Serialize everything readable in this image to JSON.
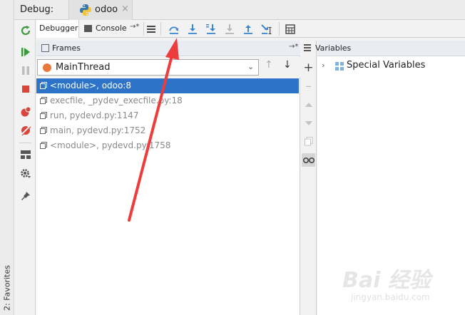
{
  "title_bar": {
    "debug_label": "Debug:",
    "run_tab_label": "odoo",
    "run_tab_close": "×"
  },
  "favorites": {
    "label": "2: Favorites"
  },
  "tabs": {
    "debugger": "Debugger",
    "console": "Console",
    "console_pin": "→*"
  },
  "frames": {
    "title": "Frames",
    "pin": "→*",
    "thread": "MainThread",
    "items": [
      {
        "label": "<module>, odoo:8",
        "selected": true
      },
      {
        "label": "execfile, _pydev_execfile.py:18",
        "selected": false
      },
      {
        "label": "run, pydevd.py:1147",
        "selected": false
      },
      {
        "label": "main, pydevd.py:1752",
        "selected": false
      },
      {
        "label": "<module>, pydevd.py:1758",
        "selected": false
      }
    ]
  },
  "variables": {
    "title": "Variables",
    "special_label": "Special Variables"
  },
  "watermark": {
    "brand": "Bai 经验",
    "url": "jingyan.baidu.com"
  },
  "colors": {
    "selection": "#2d74c9",
    "accent_blue": "#3a87d4",
    "arrow": "#ee3b3b",
    "thread_dot": "#e9783d"
  }
}
